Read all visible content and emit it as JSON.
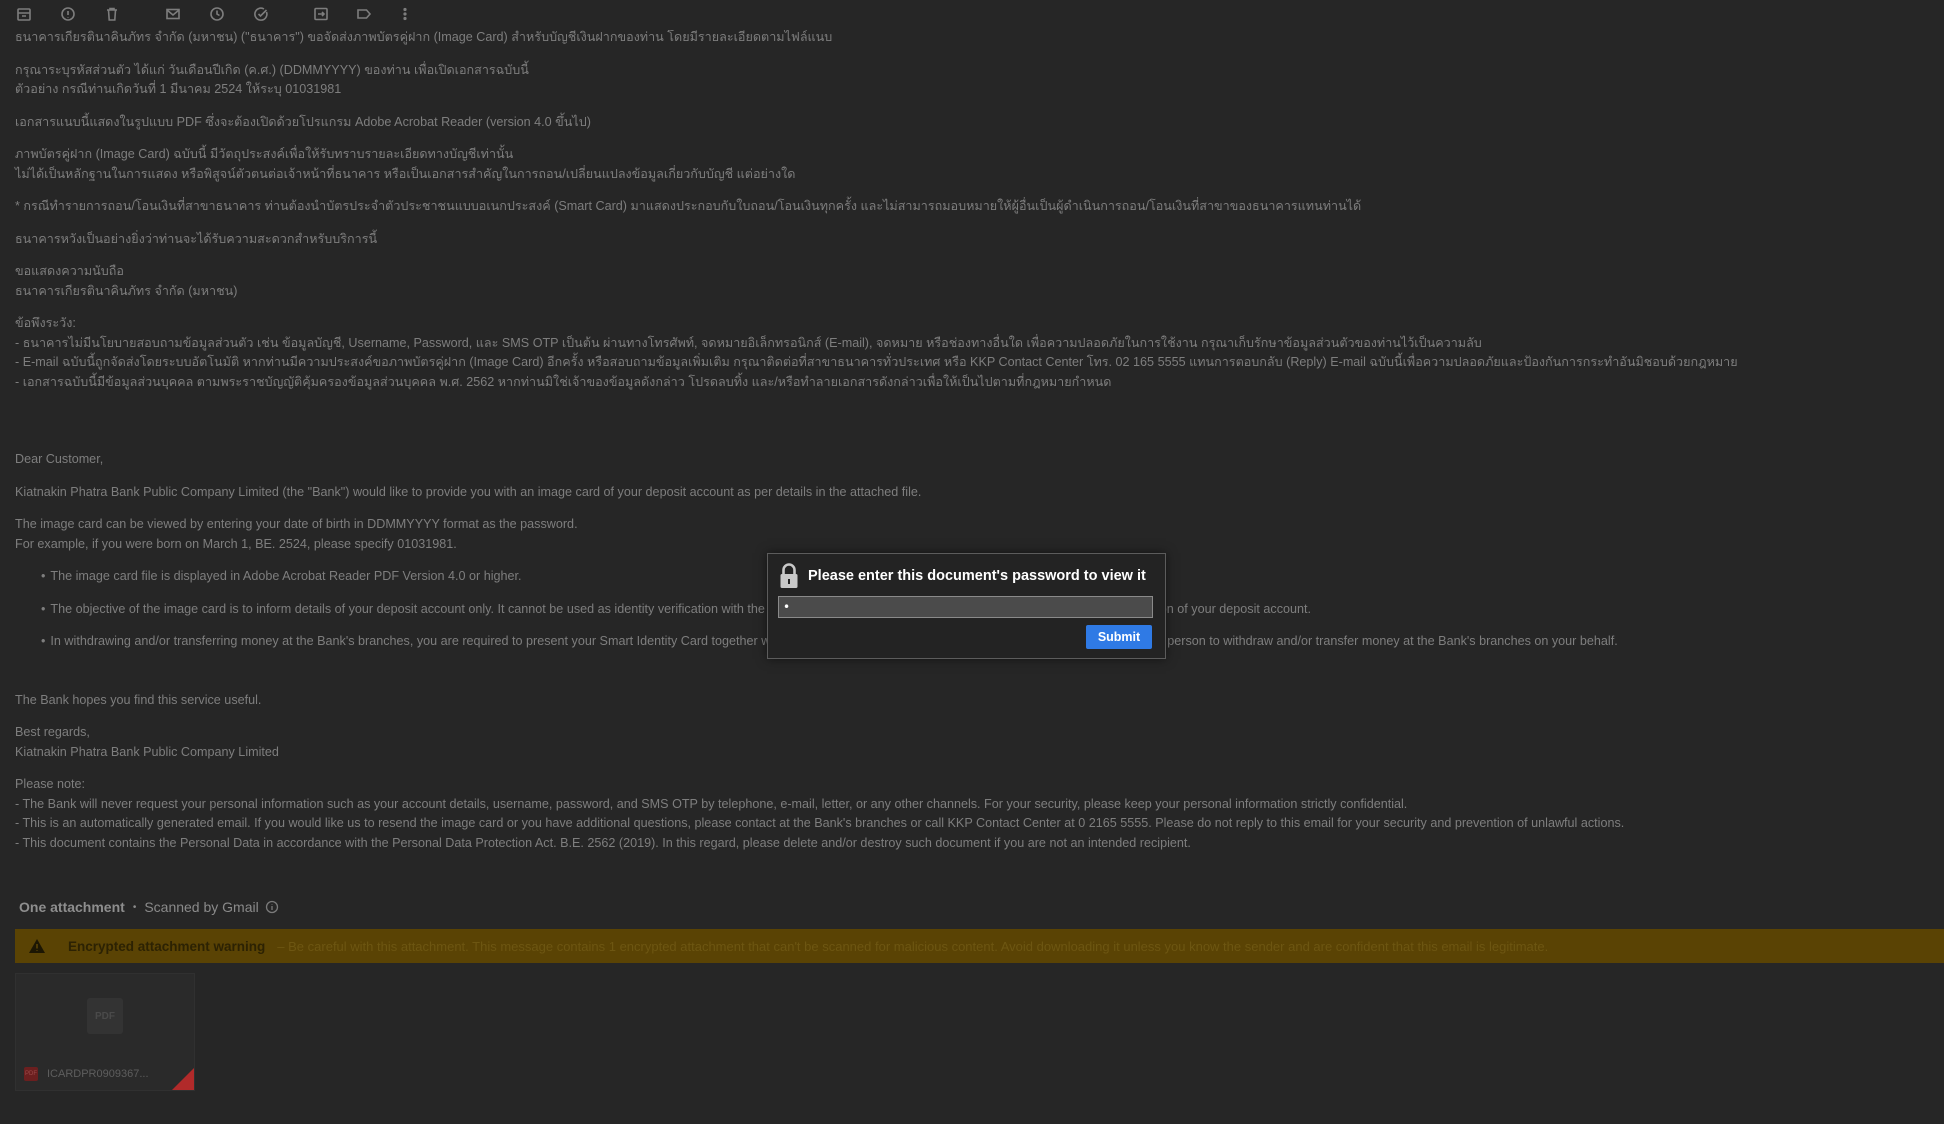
{
  "toolbar": {
    "icons": [
      "archive-icon",
      "report-spam-icon",
      "delete-icon",
      "mark-unread-icon",
      "snooze-icon",
      "add-task-icon",
      "move-to-icon",
      "label-icon",
      "more-icon"
    ]
  },
  "email": {
    "thai": {
      "p0": "ธนาคารเกียรตินาคินภัทร จำกัด (มหาชน) (\"ธนาคาร\") ขอจัดส่งภาพบัตรคู่ฝาก (Image Card) สำหรับบัญชีเงินฝากของท่าน โดยมีรายละเอียดตามไฟล์แนบ",
      "p1_l1": "กรุณาระบุรหัสส่วนตัว ได้แก่ วันเดือนปีเกิด (ค.ศ.) (DDMMYYYY) ของท่าน เพื่อเปิดเอกสารฉบับนี้",
      "p1_l2": "ตัวอย่าง กรณีท่านเกิดวันที่ 1 มีนาคม 2524 ให้ระบุ 01031981",
      "p2": "เอกสารแนบนี้แสดงในรูปแบบ PDF ซึ่งจะต้องเปิดด้วยโปรแกรม Adobe Acrobat Reader (version 4.0 ขึ้นไป)",
      "p3_l1": "ภาพบัตรคู่ฝาก (Image Card) ฉบับนี้ มีวัตถุประสงค์เพื่อให้รับทราบรายละเอียดทางบัญชีเท่านั้น",
      "p3_l2": "ไม่ได้เป็นหลักฐานในการแสดง หรือพิสูจน์ตัวตนต่อเจ้าหน้าที่ธนาคาร หรือเป็นเอกสารสำคัญในการถอน/เปลี่ยนแปลงข้อมูลเกี่ยวกับบัญชี แต่อย่างใด",
      "p4": "* กรณีทำรายการถอน/โอนเงินที่สาขาธนาคาร ท่านต้องนำบัตรประจำตัวประชาชนแบบอเนกประสงค์ (Smart Card) มาแสดงประกอบกับใบถอน/โอนเงินทุกครั้ง และไม่สามารถมอบหมายให้ผู้อื่นเป็นผู้ดำเนินการถอน/โอนเงินที่สาขาของธนาคารแทนท่านได้",
      "p5": "ธนาคารหวังเป็นอย่างยิ่งว่าท่านจะได้รับความสะดวกสำหรับบริการนี้",
      "p6_l1": "ขอแสดงความนับถือ",
      "p6_l2": "ธนาคารเกียรตินาคินภัทร จำกัด (มหาชน)",
      "note_title": "ข้อพึงระวัง:",
      "note_1": "- ธนาคารไม่มีนโยบายสอบถามข้อมูลส่วนตัว เช่น ข้อมูลบัญชี, Username, Password, และ SMS OTP เป็นต้น ผ่านทางโทรศัพท์, จดหมายอิเล็กทรอนิกส์ (E-mail), จดหมาย หรือช่องทางอื่นใด เพื่อความปลอดภัยในการใช้งาน กรุณาเก็บรักษาข้อมูลส่วนตัวของท่านไว้เป็นความลับ",
      "note_2": "- E-mail ฉบับนี้ถูกจัดส่งโดยระบบอัตโนมัติ หากท่านมีความประสงค์ขอภาพบัตรคู่ฝาก (Image Card) อีกครั้ง หรือสอบถามข้อมูลเพิ่มเติม กรุณาติดต่อที่สาขาธนาคารทั่วประเทศ หรือ KKP Contact Center โทร. 02 165 5555 แทนการตอบกลับ (Reply) E-mail ฉบับนี้เพื่อความปลอดภัยและป้องกันการกระทำอันมิชอบด้วยกฎหมาย",
      "note_3": "- เอกสารฉบับนี้มีข้อมูลส่วนบุคคล ตามพระราชบัญญัติคุ้มครองข้อมูลส่วนบุคคล พ.ศ. 2562 หากท่านมิใช่เจ้าของข้อมูลดังกล่าว โปรดลบทิ้ง และ/หรือทำลายเอกสารดังกล่าวเพื่อให้เป็นไปตามที่กฎหมายกำหนด"
    },
    "english": {
      "greeting": "Dear Customer,",
      "intro": "Kiatnakin Phatra Bank Public Company Limited (the \"Bank\") would like to provide you with an image card of your deposit account as per details in the attached file.",
      "pw_l1": "The image card can be viewed by entering your date of birth in DDMMYYYY format as the password.",
      "pw_l2": "For example, if you were born on March 1, BE. 2524, please specify 01031981.",
      "bullet_1": "The image card file is displayed in Adobe Acrobat Reader PDF Version 4.0 or higher.",
      "bullet_2": "The objective of the image card is to inform details of your deposit account only. It cannot be used as identity verification with the Bank's officer or as an important document for withdrawal or modification of your deposit account.",
      "bullet_3": "In withdrawing and/or transferring money at the Bank's branches, you are required to present your Smart Identity Card together with the withdrawal/transfer slip every time. You shall not authorize other person to withdraw and/or transfer money at the Bank's branches on your behalf.",
      "hope": "The Bank hopes you find this service useful.",
      "regards_l1": "Best regards,",
      "regards_l2": "Kiatnakin Phatra Bank Public Company Limited",
      "note_title": "Please note:",
      "note_1": "- The Bank will never request your personal information such as your account details, username, password, and SMS OTP by telephone, e-mail, letter, or any other channels. For your security, please keep your personal information strictly confidential.",
      "note_2": "- This is an automatically generated email. If you would like us to resend the image card or you have additional questions, please contact at the Bank's branches or call KKP Contact Center at 0 2165 5555. Please do not reply to this email for your security and prevention of unlawful actions.",
      "note_3": "- This document contains the Personal Data in accordance with the Personal Data Protection Act. B.E. 2562 (2019). In this regard, please delete and/or destroy such document if you are not an intended recipient."
    }
  },
  "attachments": {
    "count_label": "One attachment",
    "scanned_label": "Scanned by Gmail",
    "warning_title": "Encrypted attachment warning",
    "warning_message": "– Be careful with this attachment. This message contains 1 encrypted attachment that can't be scanned for malicious content. Avoid downloading it unless you know the sender and are confident that this email is legitimate.",
    "file_name": "ICARDPR0909367...",
    "thumb_label": "PDF",
    "badge_label": "PDF"
  },
  "modal": {
    "title": "Please enter this document's password to view it",
    "password_value": "•",
    "submit_label": "Submit"
  },
  "colors": {
    "background": "#262626",
    "warning_bg": "#5a4304",
    "submit_blue": "#2f7ae5"
  }
}
